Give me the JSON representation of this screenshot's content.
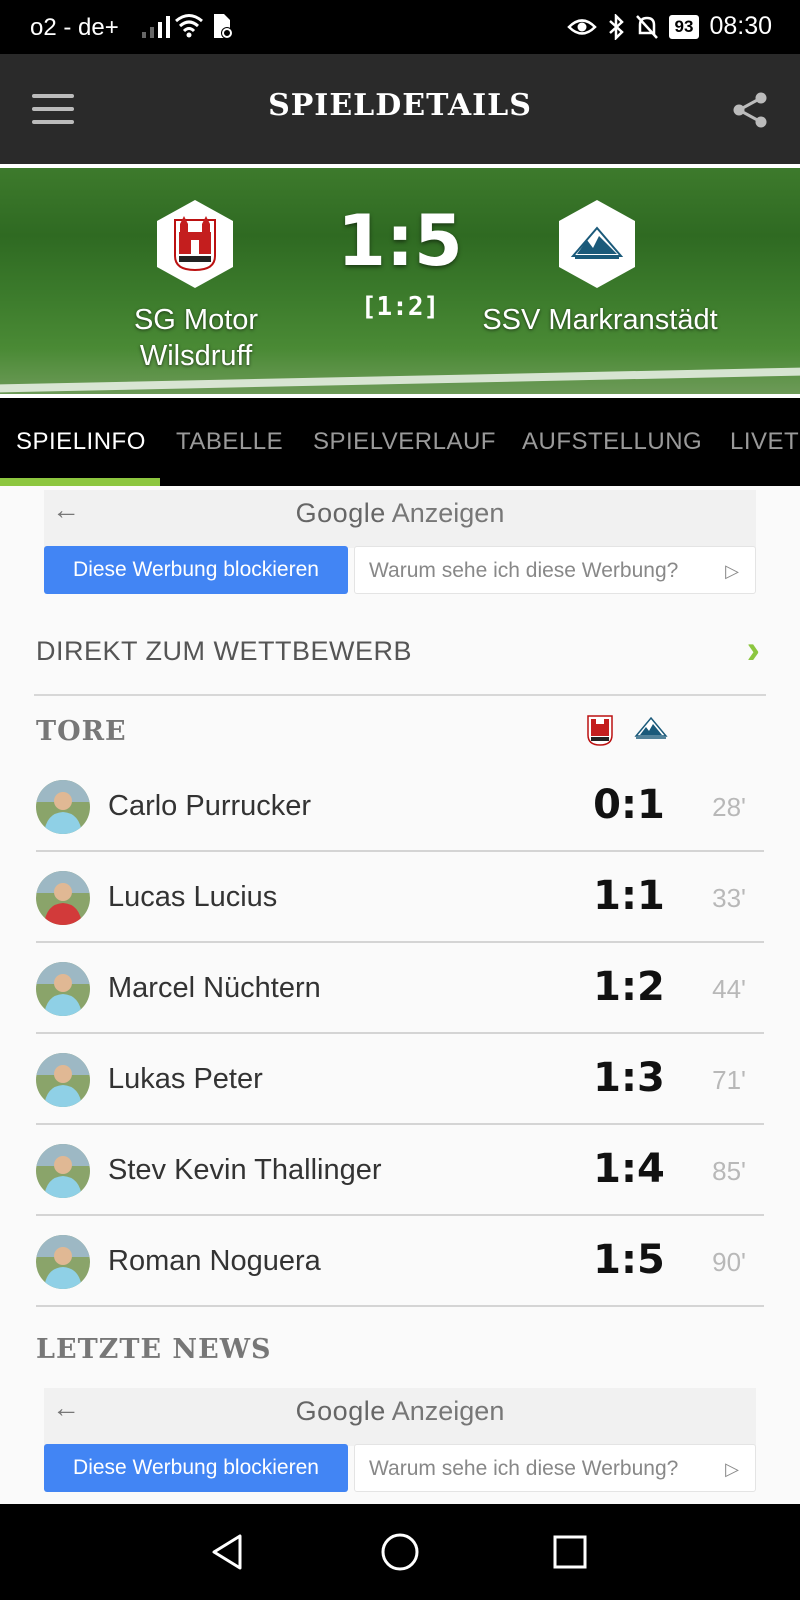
{
  "status_bar": {
    "carrier": "o2 - de+",
    "battery": "93",
    "time": "08:30"
  },
  "app_bar": {
    "title": "SPIELDETAILS"
  },
  "match": {
    "home_team": "SG Motor Wilsdruff",
    "away_team": "SSV Markranstädt",
    "score": "1:5",
    "halftime": "[1:2]"
  },
  "tabs": [
    {
      "label": "SPIELINFO",
      "active": true
    },
    {
      "label": "TABELLE",
      "active": false
    },
    {
      "label": "SPIELVERLAUF",
      "active": false
    },
    {
      "label": "AUFSTELLUNG",
      "active": false
    },
    {
      "label": "LIVET",
      "active": false
    }
  ],
  "ads": [
    {
      "brand": "Google",
      "label": "Anzeigen",
      "block": "Diese Werbung blockieren",
      "why": "Warum sehe ich diese Werbung?"
    },
    {
      "brand": "Google",
      "label": "Anzeigen",
      "block": "Diese Werbung blockieren",
      "why": "Warum sehe ich diese Werbung?"
    }
  ],
  "direct_link": "DIREKT ZUM WETTBEWERB",
  "goals_section": {
    "title": "TORE",
    "goals": [
      {
        "player": "Carlo Purrucker",
        "score": "0:1",
        "minute": "28'",
        "shirt": "#8fd0e6"
      },
      {
        "player": "Lucas Lucius",
        "score": "1:1",
        "minute": "33'",
        "shirt": "#d23a3a"
      },
      {
        "player": "Marcel Nüchtern",
        "score": "1:2",
        "minute": "44'",
        "shirt": "#8fd0e6"
      },
      {
        "player": "Lukas Peter",
        "score": "1:3",
        "minute": "71'",
        "shirt": "#8fd0e6"
      },
      {
        "player": "Stev Kevin Thallinger",
        "score": "1:4",
        "minute": "85'",
        "shirt": "#8fd0e6"
      },
      {
        "player": "Roman Noguera",
        "score": "1:5",
        "minute": "90'",
        "shirt": "#8fd0e6"
      }
    ]
  },
  "news_section": {
    "title": "LETZTE NEWS"
  },
  "colors": {
    "accent": "#8cc63f",
    "app_bar": "#2a2a2a",
    "ad_button": "#4285f4"
  }
}
